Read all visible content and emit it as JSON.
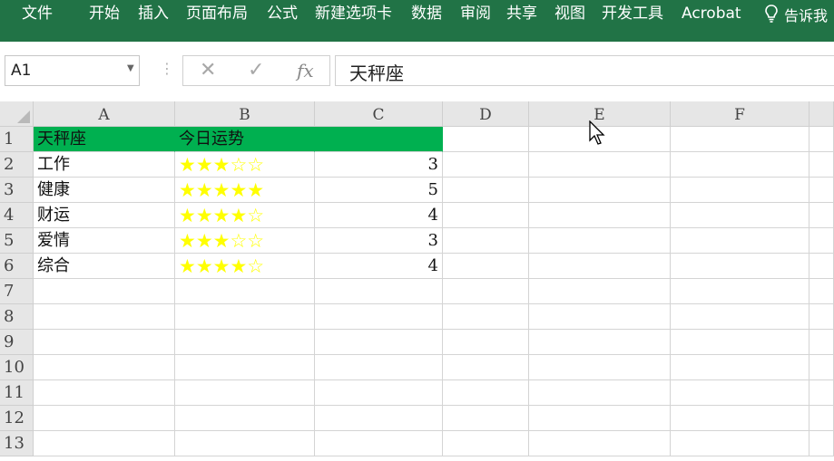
{
  "ribbon": {
    "tabs": [
      "文件",
      "开始",
      "插入",
      "页面布局",
      "公式",
      "新建选项卡",
      "数据",
      "审阅",
      "共享",
      "视图",
      "开发工具",
      "Acrobat"
    ],
    "tell_me": "告诉我"
  },
  "formula_bar": {
    "name_box": "A1",
    "cancel_glyph": "✕",
    "enter_glyph": "✓",
    "fx_label": "fx",
    "formula": "天秤座"
  },
  "columns": [
    "A",
    "B",
    "C",
    "D",
    "E",
    "F"
  ],
  "rows": [
    "1",
    "2",
    "3",
    "4",
    "5",
    "6",
    "7",
    "8",
    "9",
    "10",
    "11",
    "12",
    "13"
  ],
  "table": {
    "header": {
      "a": "天秤座",
      "b": "今日运势"
    },
    "rows": [
      {
        "a": "工作",
        "b": "★★★☆☆",
        "c": "3"
      },
      {
        "a": "健康",
        "b": "★★★★★",
        "c": "5"
      },
      {
        "a": "财运",
        "b": "★★★★☆",
        "c": "4"
      },
      {
        "a": "爱情",
        "b": "★★★☆☆",
        "c": "3"
      },
      {
        "a": "综合",
        "b": "★★★★☆",
        "c": "4"
      }
    ]
  },
  "colors": {
    "ribbon": "#217346",
    "header_fill": "#00b050",
    "star": "#ffff00"
  }
}
